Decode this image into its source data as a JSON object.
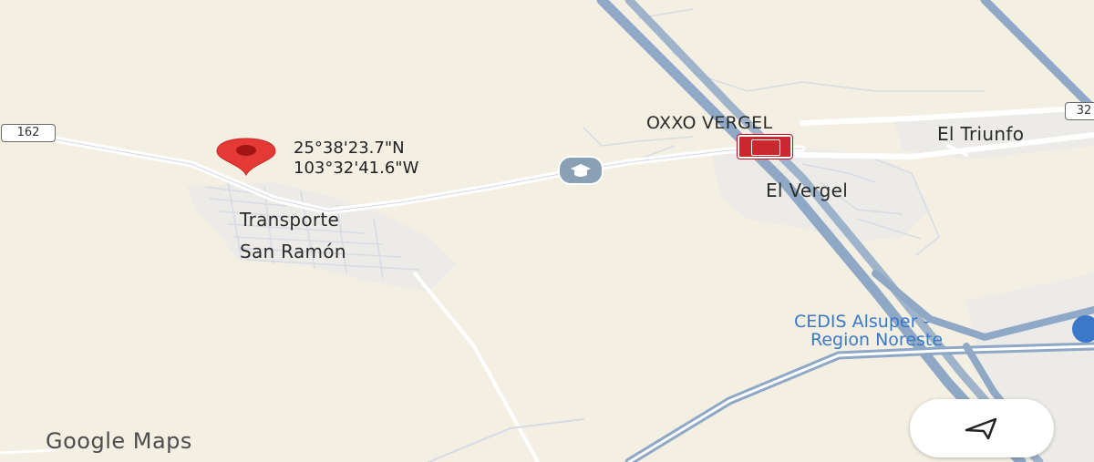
{
  "pin": {
    "latitude": "25°38'23.7\"N",
    "longitude": "103°32'41.6\"W"
  },
  "labels": {
    "place1_line1": "Transporte",
    "place1_line2": "San Ramón",
    "oxxo": "OXXO VERGEL",
    "el_vergel": "El Vergel",
    "el_triunfo": "El Triunfo",
    "cedis_line1": "CEDIS Alsuper -",
    "cedis_line2": "Region Noreste"
  },
  "route_shields": {
    "left": "162",
    "right": "32"
  },
  "branding": {
    "text": "Google Maps"
  },
  "colors": {
    "land": "#f3efe2",
    "highway": "#8fa8c5",
    "road": "#ffffff",
    "settlement": "#e9e9e6",
    "pin": "#e53935",
    "poi_blue": "#3b78c8",
    "store_red": "#c8282e"
  },
  "icons": {
    "pin": "map-pin-icon",
    "school": "graduation-cap-icon",
    "store": "store-icon",
    "navigate": "navigation-arrow-icon"
  }
}
